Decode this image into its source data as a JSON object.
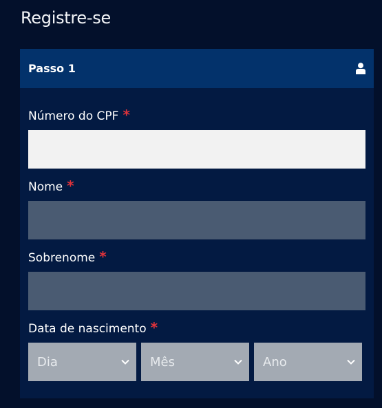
{
  "page": {
    "title": "Registre-se"
  },
  "step": {
    "title": "Passo 1",
    "icon": "user-icon"
  },
  "fields": {
    "cpf": {
      "label": "Número do CPF",
      "required_mark": "*",
      "value": ""
    },
    "nome": {
      "label": "Nome",
      "required_mark": "*",
      "value": ""
    },
    "sobrenome": {
      "label": "Sobrenome",
      "required_mark": "*",
      "value": ""
    },
    "nascimento": {
      "label": "Data de nascimento",
      "required_mark": "*",
      "day": {
        "selected": "Dia",
        "icon": "chevron-down-icon"
      },
      "month": {
        "selected": "Mês",
        "icon": "chevron-down-icon"
      },
      "year": {
        "selected": "Ano",
        "icon": "chevron-down-icon"
      }
    }
  },
  "colors": {
    "background": "#03102b",
    "panel": "#031a42",
    "panel_header": "#03326b",
    "required": "#e0333b",
    "input_active": "#f2f2f2",
    "input_disabled": "#4a5b72",
    "select_disabled": "#a3aab3"
  }
}
